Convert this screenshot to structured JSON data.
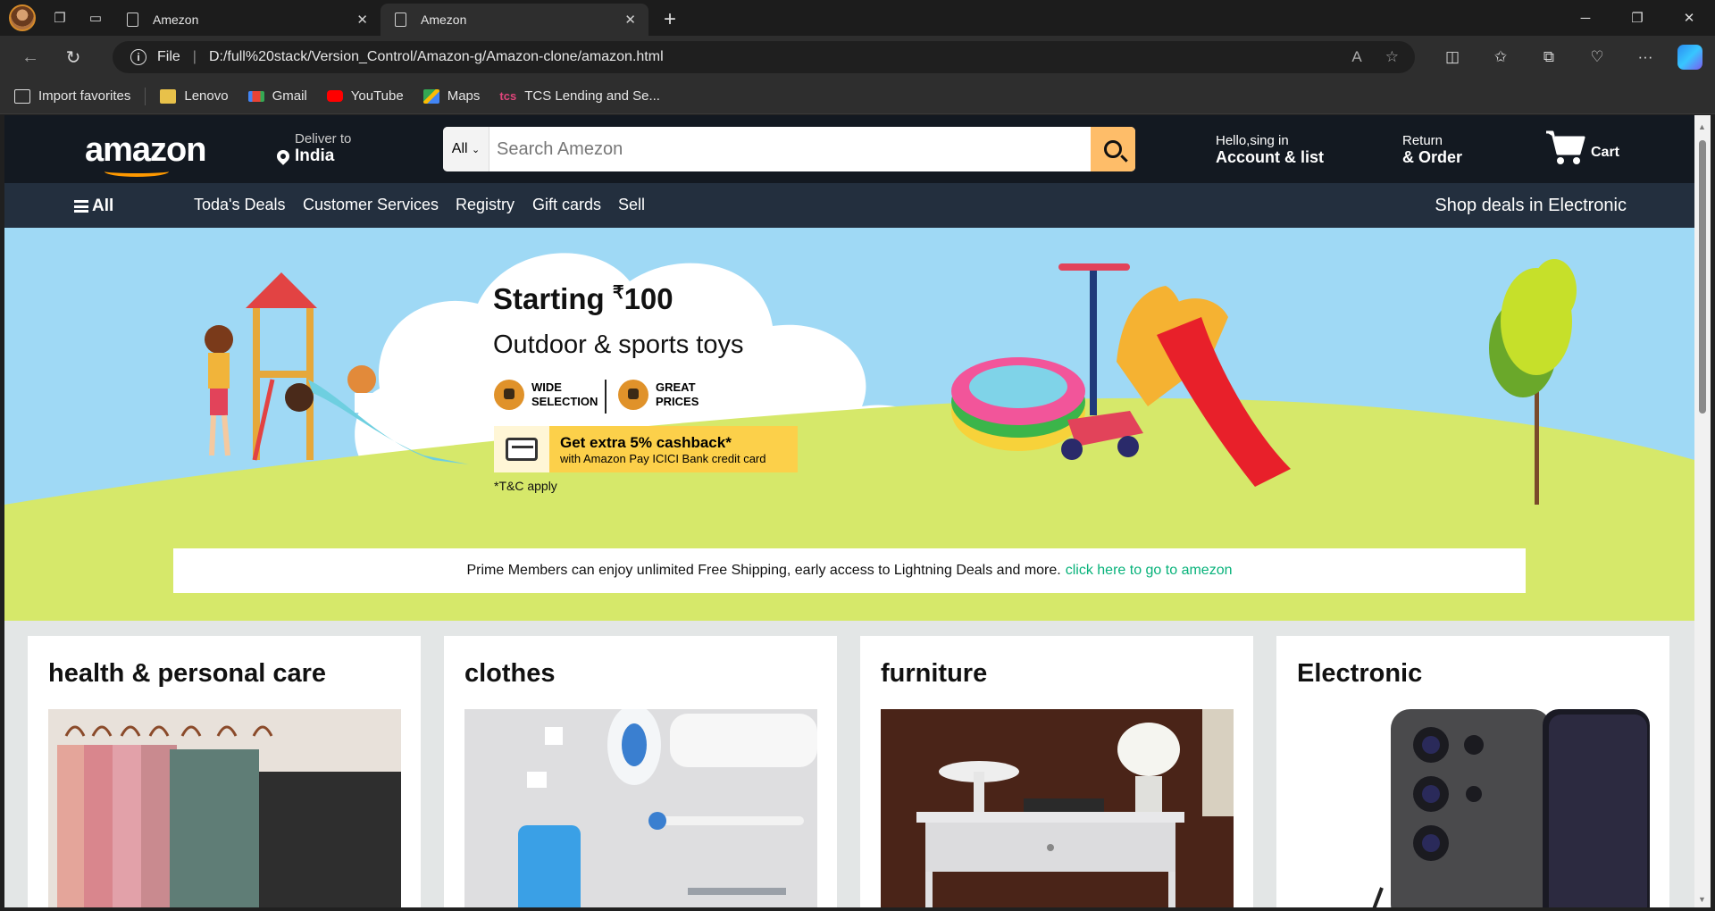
{
  "browser": {
    "tabs": [
      {
        "title": "Amezon",
        "active": false
      },
      {
        "title": "Amezon",
        "active": true
      }
    ],
    "address": {
      "scheme_label": "File",
      "url": "D:/full%20stack/Version_Control/Amazon-g/Amazon-clone/amazon.html"
    },
    "favorites": [
      {
        "label": "Import favorites",
        "icon": "import-icon"
      },
      {
        "label": "Lenovo",
        "icon": "folder-icon"
      },
      {
        "label": "Gmail",
        "icon": "gmail-icon"
      },
      {
        "label": "YouTube",
        "icon": "youtube-icon"
      },
      {
        "label": "Maps",
        "icon": "maps-icon"
      },
      {
        "label": "TCS Lending and Se...",
        "icon": "tcs-icon"
      }
    ]
  },
  "header": {
    "logo": "amazon",
    "deliver_label": "Deliver to",
    "deliver_location": "India",
    "search": {
      "category": "All",
      "placeholder": "Search Amezon"
    },
    "account": {
      "line1": "Hello,sing in",
      "line2": "Account & list"
    },
    "orders": {
      "line1": "Return",
      "line2": "& Order"
    },
    "cart_label": "Cart"
  },
  "subnav": {
    "all_label": "All",
    "items": [
      "Toda's Deals",
      "Customer Services",
      "Registry",
      "Gift cards",
      "Sell"
    ],
    "promo": "Shop deals in Electronic"
  },
  "hero": {
    "starting_text": "Starting",
    "currency": "₹",
    "price": "100",
    "subtitle": "Outdoor & sports toys",
    "badge1_line1": "WIDE",
    "badge1_line2": "SELECTION",
    "badge2_line1": "GREAT",
    "badge2_line2": "PRICES",
    "promo_line1": "Get extra 5% cashback*",
    "promo_line2": "with Amazon Pay ICICI Bank credit card",
    "tc": "*T&C apply"
  },
  "prime": {
    "text": "Prime Members can enjoy unlimited Free Shipping, early access to Lightning Deals and more.",
    "link": "click here to go to amezon"
  },
  "categories": [
    {
      "title": "health & personal care"
    },
    {
      "title": "clothes"
    },
    {
      "title": "furniture"
    },
    {
      "title": "Electronic"
    }
  ],
  "colors": {
    "header_bg": "#131921",
    "subnav_bg": "#232f3e",
    "accent": "#febd69",
    "link_green": "#07b27a"
  }
}
